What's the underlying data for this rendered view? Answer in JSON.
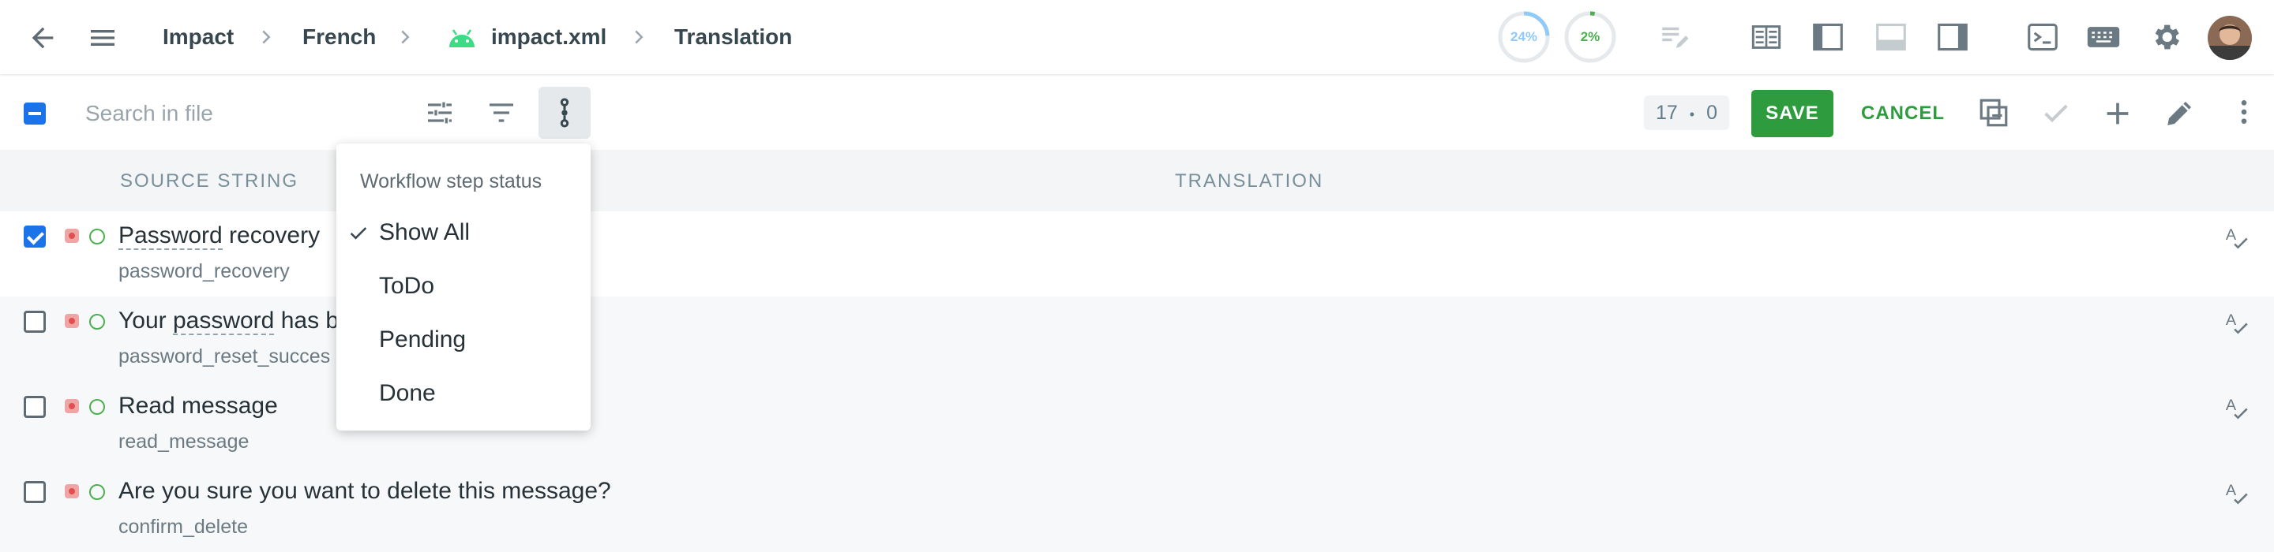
{
  "breadcrumb": {
    "project": "Impact",
    "language": "French",
    "file": "impact.xml",
    "view": "Translation"
  },
  "progress": {
    "translated_label": "24%",
    "translated_value": 0.24,
    "approved_label": "2%",
    "approved_value": 0.02
  },
  "toolbar": {
    "search_placeholder": "Search in file",
    "counter_total": "17",
    "counter_sep": "•",
    "counter_selected": "0",
    "save_label": "SAVE",
    "cancel_label": "CANCEL"
  },
  "columns": {
    "source": "SOURCE STRING",
    "translation": "TRANSLATION"
  },
  "rows": [
    {
      "text_a": "Password",
      "text_b": " recovery",
      "key": "password_recovery",
      "checked": true
    },
    {
      "text_a": "Your ",
      "text_b": "password",
      "text_c": " has b",
      "key": "password_reset_succes",
      "checked": false
    },
    {
      "text": "Read message",
      "key": "read_message",
      "checked": false
    },
    {
      "text": "Are you sure you want to delete this message?",
      "key": "confirm_delete",
      "checked": false
    }
  ],
  "dropdown": {
    "title": "Workflow step status",
    "items": [
      "Show All",
      "ToDo",
      "Pending",
      "Done"
    ],
    "selected": "Show All"
  },
  "colors": {
    "accent_green": "#2e9c3e",
    "checkbox_blue": "#1a73e8",
    "progress_blue": "#90caf9",
    "progress_green": "#4caf50"
  }
}
